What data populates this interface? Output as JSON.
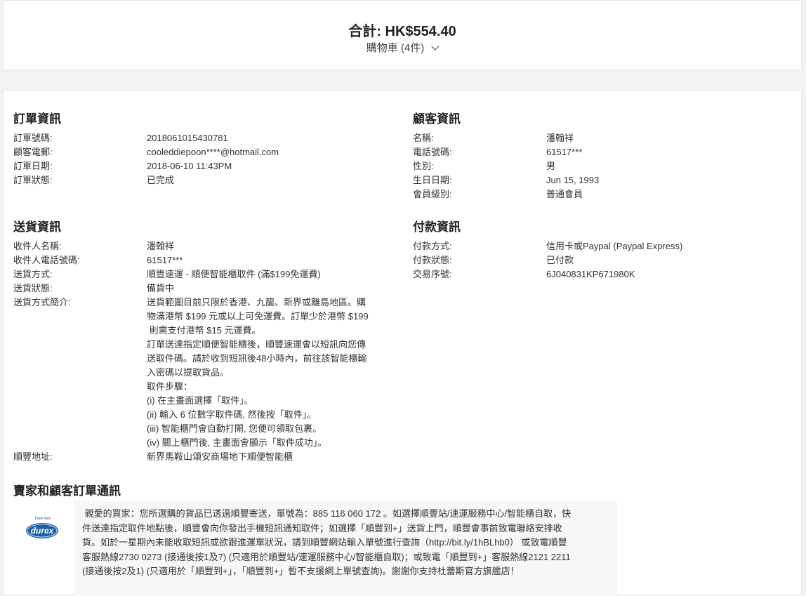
{
  "summary": {
    "total_label": "合計: HK$554.40",
    "cart_label": "購物車 (4件)"
  },
  "order_info": {
    "title": "訂單資訊",
    "rows": [
      {
        "label": "訂單號碼:",
        "value": "2018061015430781"
      },
      {
        "label": "顧客電郵:",
        "value": "cooleddiepoon****@hotmail.com"
      },
      {
        "label": "訂單日期:",
        "value": "2018-06-10 11:43PM"
      },
      {
        "label": "訂單狀態:",
        "value": "已完成"
      }
    ]
  },
  "customer_info": {
    "title": "顧客資訊",
    "rows": [
      {
        "label": "名稱:",
        "value": "潘翰祥"
      },
      {
        "label": "電話號碼:",
        "value": "61517***"
      },
      {
        "label": "性別:",
        "value": "男"
      },
      {
        "label": "生日日期:",
        "value": "Jun 15, 1993"
      },
      {
        "label": "會員級別:",
        "value": "普通會員"
      }
    ]
  },
  "shipping_info": {
    "title": "送貨資訊",
    "rows": [
      {
        "label": "收件人名稱:",
        "value": "潘翰祥"
      },
      {
        "label": "收件人電話號碼:",
        "value": "61517***"
      },
      {
        "label": "送貨方式:",
        "value": "順豐速運 - 順便智能櫃取件 (滿$199免運費)"
      },
      {
        "label": "送貨狀態:",
        "value": "備貨中"
      },
      {
        "label": "送貨方式簡介:",
        "value": ""
      }
    ],
    "description_lines": [
      "送貨範圍目前只限於香港、九龍、新界或離島地區。購",
      "物滿港幣 $199 元或以上可免運費。訂單少於港幣 $199",
      " 則需支付港幣 $15 元運費。",
      "訂單送達指定順便智能櫃後，順豐速運會以短訊向您傳",
      "送取件碼。請於收到短訊後48小時內，前往該智能櫃輸",
      "入密碼以提取貨品。",
      "取件步驟：",
      "(i) 在主畫面選擇「取件」。",
      "(ii) 輸入 6 位數字取件碼, 然後按「取件」。",
      "(iii) 智能櫃門會自動打開, 您便可領取包裹。",
      "(iv) 關上櫃門後, 主畫面會顯示「取件成功」。"
    ],
    "address_label": "順豐地址:",
    "address_value": "新界馬鞍山頌安商場地下順便智能櫃"
  },
  "payment_info": {
    "title": "付款資訊",
    "rows": [
      {
        "label": "付款方式:",
        "value": "信用卡或Paypal (Paypal Express)"
      },
      {
        "label": "付款狀態:",
        "value": "已付款"
      },
      {
        "label": "交易序號:",
        "value": "6J040831KP671980K"
      }
    ]
  },
  "communication": {
    "title": "賣家和顧客訂單通訊",
    "logo_text": "durex",
    "logo_tagline": "love sex",
    "message_lines": [
      " 親愛的買家：您所選購的貨品已透過順豐寄送，單號為：885 116 060 172 。如選擇順豐站/速運服務中心/智能櫃自取，快",
      "件送達指定取件地點後，順豐會向你發出手機短訊通知取件；如選擇「順豐到+」送貨上門，順豐會事前致電聯絡安排收",
      "貨。如於一星期內未能收取短訊或欲跟進運單狀況，請到順豐網站輸入單號進行查詢（http://bit.ly/1hBLhb0） 或致電順豐",
      "客服熱線2730 0273 (接通後按1及7) (只適用於順豐站/速運服務中心/智能櫃自取)；或致電「順豐到+」客服熱線2121 2211",
      "(接通後按2及1) (只適用於「順豐到+」，「順豐到+」暫不支援網上單號查詢)。謝謝你支持杜蕾斯官方旗艦店！"
    ]
  },
  "colors": {
    "background": "#f2f2f2",
    "card": "#ffffff",
    "message_bg": "#f7f7f7",
    "logo_blue": "#1a5fa8"
  }
}
